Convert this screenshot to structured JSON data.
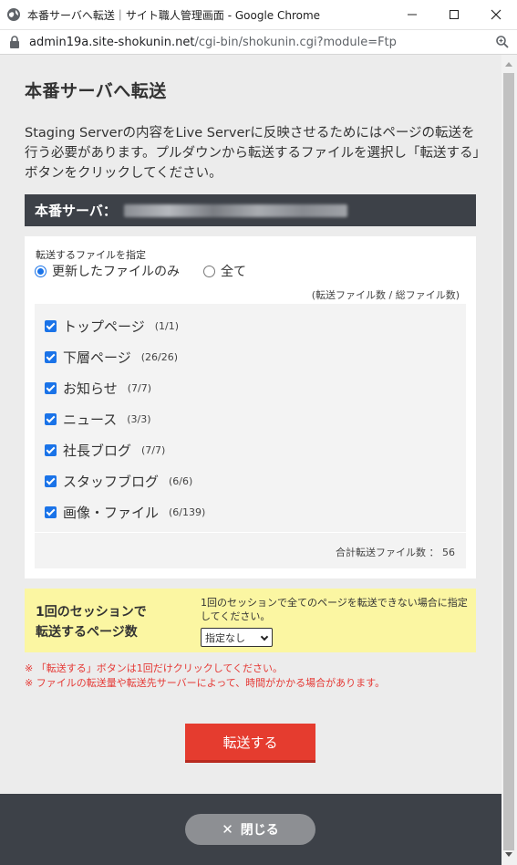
{
  "window": {
    "title": "本番サーバへ転送｜サイト職人管理画面 - Google Chrome",
    "url_host": "admin19a.site-shokunin.net",
    "url_path": "/cgi-bin/shokunin.cgi?module=Ftp"
  },
  "page": {
    "title": "本番サーバへ転送",
    "intro": "Staging Serverの内容をLive Serverに反映させるためにはページの転送を行う必要があります。プルダウンから転送するファイルを選択し「転送する」ボタンをクリックしてください。",
    "server_label": "本番サーバ："
  },
  "file_spec": {
    "label": "転送するファイルを指定",
    "options": [
      {
        "label": "更新したファイルのみ",
        "selected": true
      },
      {
        "label": "全て",
        "selected": false
      }
    ],
    "count_note": "(転送ファイル数 / 総ファイル数)",
    "files": [
      {
        "name": "トップページ",
        "count": "(1/1)",
        "checked": true
      },
      {
        "name": "下層ページ",
        "count": "(26/26)",
        "checked": true
      },
      {
        "name": "お知らせ",
        "count": "(7/7)",
        "checked": true
      },
      {
        "name": "ニュース",
        "count": "(3/3)",
        "checked": true
      },
      {
        "name": "社長ブログ",
        "count": "(7/7)",
        "checked": true
      },
      {
        "name": "スタッフブログ",
        "count": "(6/6)",
        "checked": true
      },
      {
        "name": "画像・ファイル",
        "count": "(6/139)",
        "checked": true
      }
    ],
    "total": "合計転送ファイル数 ： 56"
  },
  "session": {
    "heading_line1": "1回のセッションで",
    "heading_line2": "転送するページ数",
    "description": "1回のセッションで全てのページを転送できない場合に指定してください。",
    "select_value": "指定なし"
  },
  "notes": [
    "※ 「転送する」ボタンは1回だけクリックしてください。",
    "※ ファイルの転送量や転送先サーバーによって、時間がかかる場合があります。"
  ],
  "buttons": {
    "submit": "転送する",
    "close": "閉じる"
  },
  "colors": {
    "accent": "#1a73e8",
    "submit": "#e53c2f",
    "dark_bar": "#3d4148",
    "notice": "#fbf6a2",
    "warning_text": "#e53935"
  },
  "icons": [
    "globe-icon",
    "minimize-icon",
    "maximize-icon",
    "close-window-icon",
    "lock-icon",
    "zoom-icon",
    "close-icon"
  ]
}
